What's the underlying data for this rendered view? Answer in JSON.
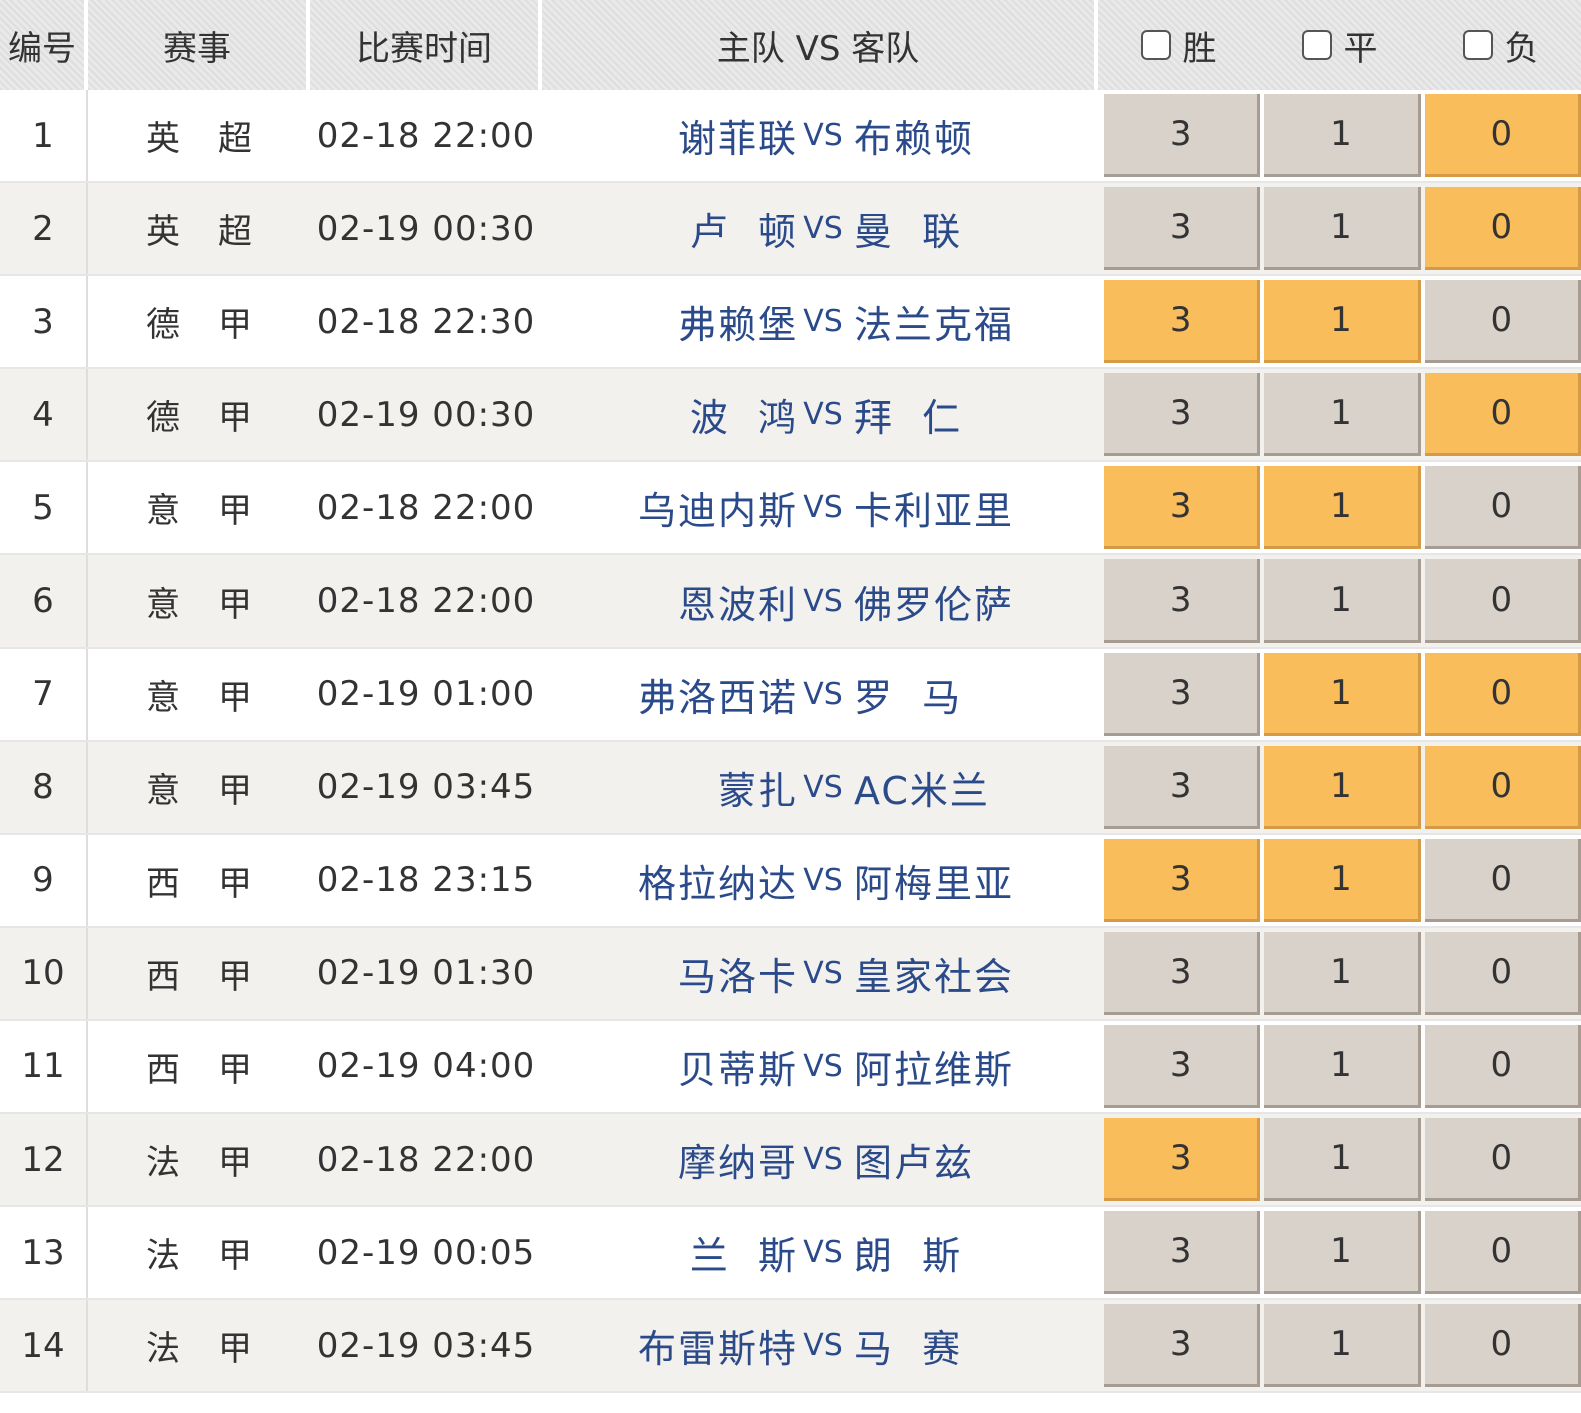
{
  "header": {
    "no": "编号",
    "league": "赛事",
    "time": "比赛时间",
    "match": "主队 VS 客队",
    "win": "胜",
    "draw": "平",
    "lose": "负"
  },
  "colors": {
    "selected": "#f9bd5c",
    "unselected": "#d9d2cb",
    "team_text": "#2b4a8a"
  },
  "rows": [
    {
      "no": "1",
      "league": "英超",
      "time": "02-18 22:00",
      "home": "谢菲联",
      "away": "布赖顿",
      "odds": [
        "3",
        "1",
        "0"
      ],
      "selected": [
        false,
        false,
        true
      ]
    },
    {
      "no": "2",
      "league": "英超",
      "time": "02-19 00:30",
      "home": "卢  顿",
      "away": "曼  联",
      "odds": [
        "3",
        "1",
        "0"
      ],
      "selected": [
        false,
        false,
        true
      ]
    },
    {
      "no": "3",
      "league": "德甲",
      "time": "02-18 22:30",
      "home": "弗赖堡",
      "away": "法兰克福",
      "odds": [
        "3",
        "1",
        "0"
      ],
      "selected": [
        true,
        true,
        false
      ]
    },
    {
      "no": "4",
      "league": "德甲",
      "time": "02-19 00:30",
      "home": "波  鸿",
      "away": "拜  仁",
      "odds": [
        "3",
        "1",
        "0"
      ],
      "selected": [
        false,
        false,
        true
      ]
    },
    {
      "no": "5",
      "league": "意甲",
      "time": "02-18 22:00",
      "home": "乌迪内斯",
      "away": "卡利亚里",
      "odds": [
        "3",
        "1",
        "0"
      ],
      "selected": [
        true,
        true,
        false
      ]
    },
    {
      "no": "6",
      "league": "意甲",
      "time": "02-18 22:00",
      "home": "恩波利",
      "away": "佛罗伦萨",
      "odds": [
        "3",
        "1",
        "0"
      ],
      "selected": [
        false,
        false,
        false
      ]
    },
    {
      "no": "7",
      "league": "意甲",
      "time": "02-19 01:00",
      "home": "弗洛西诺",
      "away": "罗  马",
      "odds": [
        "3",
        "1",
        "0"
      ],
      "selected": [
        false,
        true,
        true
      ]
    },
    {
      "no": "8",
      "league": "意甲",
      "time": "02-19 03:45",
      "home": "蒙扎",
      "away": "AC米兰",
      "odds": [
        "3",
        "1",
        "0"
      ],
      "selected": [
        false,
        true,
        true
      ]
    },
    {
      "no": "9",
      "league": "西甲",
      "time": "02-18 23:15",
      "home": "格拉纳达",
      "away": "阿梅里亚",
      "odds": [
        "3",
        "1",
        "0"
      ],
      "selected": [
        true,
        true,
        false
      ]
    },
    {
      "no": "10",
      "league": "西甲",
      "time": "02-19 01:30",
      "home": "马洛卡",
      "away": "皇家社会",
      "odds": [
        "3",
        "1",
        "0"
      ],
      "selected": [
        false,
        false,
        false
      ]
    },
    {
      "no": "11",
      "league": "西甲",
      "time": "02-19 04:00",
      "home": "贝蒂斯",
      "away": "阿拉维斯",
      "odds": [
        "3",
        "1",
        "0"
      ],
      "selected": [
        false,
        false,
        false
      ]
    },
    {
      "no": "12",
      "league": "法甲",
      "time": "02-18 22:00",
      "home": "摩纳哥",
      "away": "图卢兹",
      "odds": [
        "3",
        "1",
        "0"
      ],
      "selected": [
        true,
        false,
        false
      ]
    },
    {
      "no": "13",
      "league": "法甲",
      "time": "02-19 00:05",
      "home": "兰  斯",
      "away": "朗  斯",
      "odds": [
        "3",
        "1",
        "0"
      ],
      "selected": [
        false,
        false,
        false
      ]
    },
    {
      "no": "14",
      "league": "法甲",
      "time": "02-19 03:45",
      "home": "布雷斯特",
      "away": "马  赛",
      "odds": [
        "3",
        "1",
        "0"
      ],
      "selected": [
        false,
        false,
        false
      ]
    }
  ]
}
